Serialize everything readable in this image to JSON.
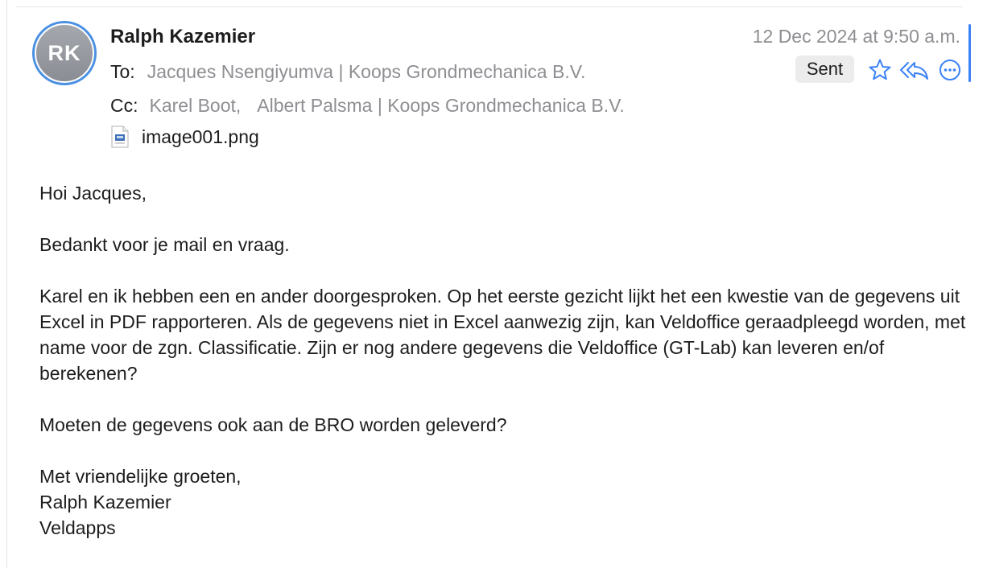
{
  "header": {
    "avatar_initials": "RK",
    "sender": "Ralph Kazemier",
    "date": "12 Dec 2024 at 9:50 a.m.",
    "to_label": "To:",
    "to_value": "Jacques Nsengiyumva | Koops Grondmechanica B.V.",
    "cc_label": "Cc:",
    "cc_values": [
      "Karel Boot,",
      "Albert Palsma | Koops Grondmechanica B.V."
    ],
    "attachment_name": "image001.png",
    "status_badge": "Sent",
    "actions": [
      "star-icon",
      "reply-all-icon",
      "more-icon"
    ]
  },
  "body": {
    "greeting": "Hoi Jacques,",
    "paragraphs": [
      "Bedankt voor je mail en vraag.",
      "Karel en ik hebben een en ander doorgesproken. Op het eerste gezicht lijkt het een kwestie van de gegevens uit Excel in PDF rapporteren. Als de gegevens niet in Excel aanwezig zijn, kan Veldoffice geraadpleegd worden, met name voor de zgn. Classificatie. Zijn er nog andere gegevens die Veldoffice (GT-Lab) kan leveren en/of berekenen?",
      "Moeten de gegevens ook aan de BRO worden geleverd?"
    ],
    "signature": [
      "Met vriendelijke groeten,",
      "Ralph Kazemier",
      "Veldapps"
    ]
  },
  "colors": {
    "accent": "#3b82f6",
    "muted_text": "#8e8e93",
    "badge_bg": "#ececec",
    "avatar_ring": "#4a90e2"
  }
}
